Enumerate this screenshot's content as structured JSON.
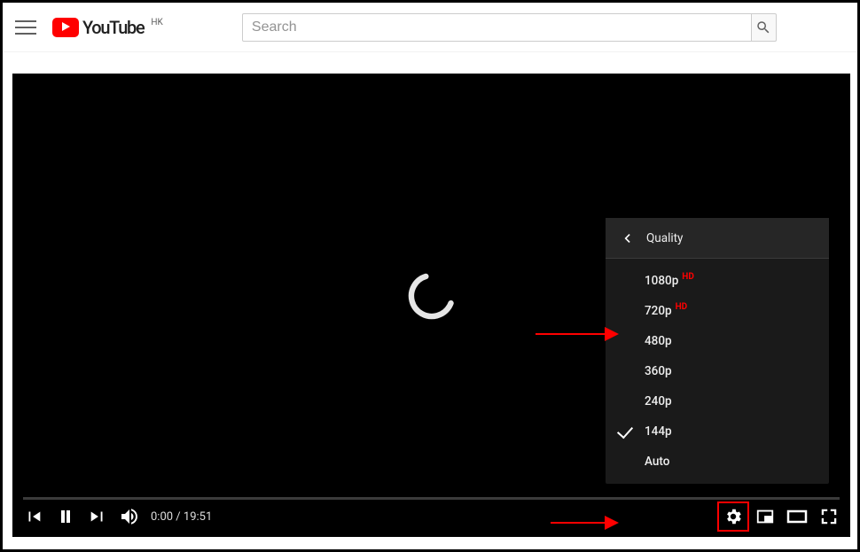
{
  "header": {
    "brand": "YouTube",
    "region": "HK",
    "search_placeholder": "Search"
  },
  "player": {
    "current_time": "0:00",
    "separator": " / ",
    "duration": "19:51"
  },
  "quality_menu": {
    "title": "Quality",
    "items": [
      {
        "label": "1080p",
        "hd": "HD",
        "selected": false
      },
      {
        "label": "720p",
        "hd": "HD",
        "selected": false
      },
      {
        "label": "480p",
        "hd": "",
        "selected": false
      },
      {
        "label": "360p",
        "hd": "",
        "selected": false
      },
      {
        "label": "240p",
        "hd": "",
        "selected": false
      },
      {
        "label": "144p",
        "hd": "",
        "selected": true
      },
      {
        "label": "Auto",
        "hd": "",
        "selected": false
      }
    ]
  },
  "annotations": {
    "highlight": "settings-button"
  }
}
